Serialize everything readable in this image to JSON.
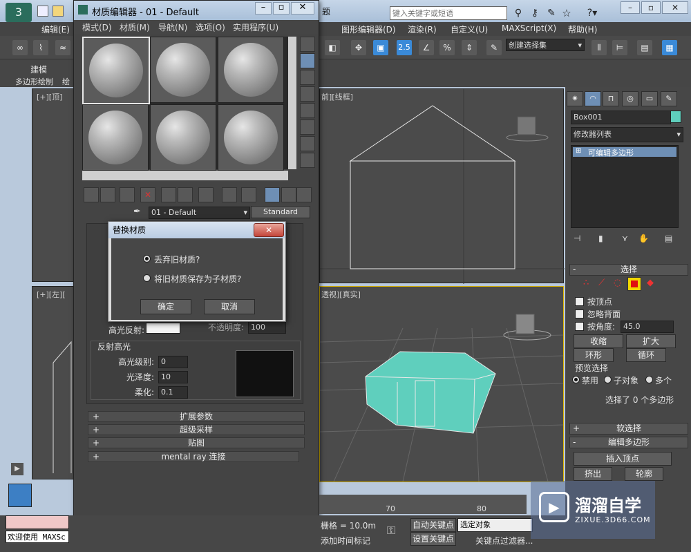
{
  "main": {
    "search_placeholder": "键入关键字或短语",
    "title_fragment": "题",
    "menus": [
      "编辑(E)",
      "图形编辑器(D)",
      "渲染(R)",
      "自定义(U)",
      "MAXScript(X)",
      "帮助(H)"
    ],
    "selection_set": "创建选择集",
    "num_25": "2.5",
    "ribbon": {
      "tab1": "建模",
      "item1": "多边形绘制",
      "item2": "绘"
    }
  },
  "viewports": {
    "top_left": "[+][顶]",
    "top_right": "[+][前][线框]",
    "front_right_frag": "前]",
    "wire_frag": "[线框]",
    "left_label": "[+][左][",
    "persp_label": "透视][真实]"
  },
  "command_panel": {
    "object_name": "Box001",
    "modifier_list": "修改器列表",
    "stack_item": "可编辑多边形",
    "selection": {
      "title": "选择",
      "by_vertex": "按顶点",
      "ignore_backface": "忽略背面",
      "by_angle": "按角度:",
      "angle_value": "45.0",
      "shrink": "收缩",
      "grow": "扩大",
      "ring": "环形",
      "loop": "循环",
      "preview_title": "预览选择",
      "opt_disabled": "禁用",
      "opt_subobj": "子对象",
      "opt_multi": "多个",
      "status": "选择了 0 个多边形"
    },
    "soft_selection": "软选择",
    "edit_poly": "编辑多边形",
    "insert_vertex": "插入顶点",
    "extrude": "挤出",
    "outline": "轮廓"
  },
  "material_editor": {
    "title": "材质编辑器 - 01 - Default",
    "menus": [
      "模式(D)",
      "材质(M)",
      "导航(N)",
      "选项(O)",
      "实用程序(U)"
    ],
    "material_name": "01 - Default",
    "material_type": "Standard",
    "specular_label": "高光反射:",
    "opacity_label": "不透明度:",
    "opacity_value": "100",
    "spec_highlights": "反射高光",
    "spec_level_label": "高光级别:",
    "spec_level": "0",
    "gloss_label": "光泽度:",
    "gloss": "10",
    "soften_label": "柔化:",
    "soften": "0.1",
    "rollouts": [
      "扩展参数",
      "超级采样",
      "贴图",
      "mental ray 连接"
    ]
  },
  "dialog": {
    "title": "替换材质",
    "opt_discard": "丢弃旧材质?",
    "opt_keep": "将旧材质保存为子材质?",
    "ok": "确定",
    "cancel": "取消"
  },
  "status": {
    "welcome": "欢迎使用 MAXSc",
    "grid": "栅格 = 10.0m",
    "auto_key": "自动关键点",
    "set_key": "设置关键点",
    "select_object": "选定对象",
    "key_filters": "关键点过滤器...",
    "add_time_tag": "添加时间标记",
    "ruler_70": "70",
    "ruler_80": "80"
  },
  "watermark": {
    "brand": "溜溜自学",
    "url": "ZIXUE.3D66.COM"
  }
}
